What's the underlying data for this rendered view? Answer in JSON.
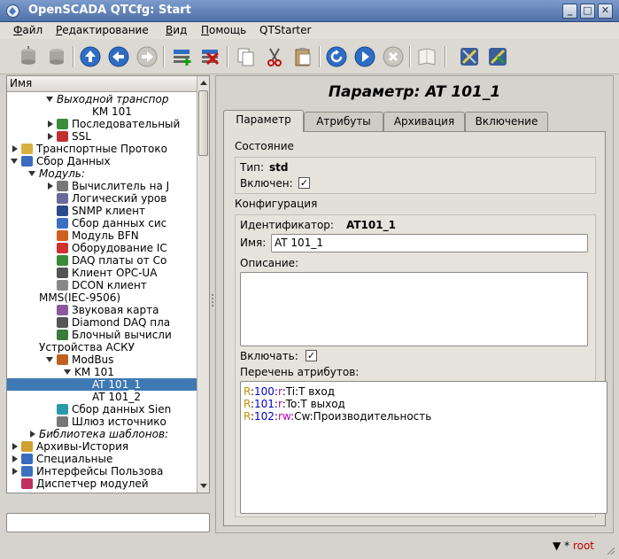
{
  "window": {
    "title": "OpenSCADA QTCfg: Start"
  },
  "menu": [
    {
      "label": "Файл",
      "underline": "Ф",
      "rest": "айл"
    },
    {
      "label": "Редактирование",
      "underline": "Р",
      "rest": "едактирование"
    },
    {
      "label": "Вид",
      "underline": "В",
      "rest": "ид"
    },
    {
      "label": "Помощь",
      "underline": "П",
      "rest": "омощь"
    },
    {
      "label": "QTStarter",
      "underline": "",
      "rest": "QTStarter"
    }
  ],
  "toolbar": {
    "icons": [
      "db-load-icon",
      "db-save-icon",
      "up-icon",
      "back-icon",
      "forward-icon",
      "add-item-icon",
      "delete-item-icon",
      "copy-icon",
      "cut-icon",
      "paste-icon",
      "refresh-icon",
      "start-icon",
      "stop-icon",
      "manual-icon",
      "tools-icon-1",
      "tools-icon-2"
    ]
  },
  "tree": {
    "header": "Имя",
    "rows": [
      {
        "label": "Выходной транспор",
        "indent": 3,
        "arrow": "down",
        "italic": true,
        "icon": ""
      },
      {
        "label": "KM 101",
        "indent": 5,
        "arrow": "",
        "italic": false,
        "icon": ""
      },
      {
        "label": "Последовательный",
        "indent": 3,
        "arrow": "right",
        "italic": false,
        "icon": "serial-icon"
      },
      {
        "label": "SSL",
        "indent": 3,
        "arrow": "right",
        "italic": false,
        "icon": "ssl-icon"
      },
      {
        "label": "Транспортные Протоко",
        "indent": 1,
        "arrow": "right",
        "italic": false,
        "icon": "folder-icon"
      },
      {
        "label": "Сбор Данных",
        "indent": 1,
        "arrow": "down",
        "italic": false,
        "icon": "daq-icon"
      },
      {
        "label": "Модуль:",
        "indent": 2,
        "arrow": "down",
        "italic": true,
        "icon": ""
      },
      {
        "label": "Вычислитель на J",
        "indent": 3,
        "arrow": "right",
        "italic": false,
        "icon": "calc-icon"
      },
      {
        "label": "Логический уров",
        "indent": 3,
        "arrow": "",
        "italic": false,
        "icon": "logic-icon"
      },
      {
        "label": "SNMP клиент",
        "indent": 3,
        "arrow": "",
        "italic": false,
        "icon": "snmp-icon"
      },
      {
        "label": "Сбор данных сис",
        "indent": 3,
        "arrow": "",
        "italic": false,
        "icon": "system-icon"
      },
      {
        "label": "Модуль BFN",
        "indent": 3,
        "arrow": "",
        "italic": false,
        "icon": "bfn-icon"
      },
      {
        "label": "Оборудование IC",
        "indent": 3,
        "arrow": "",
        "italic": false,
        "icon": "icp-icon"
      },
      {
        "label": "DAQ платы от Co",
        "indent": 3,
        "arrow": "",
        "italic": false,
        "icon": "daqboard-icon"
      },
      {
        "label": "Клиент OPC-UA",
        "indent": 3,
        "arrow": "",
        "italic": false,
        "icon": "opcua-icon"
      },
      {
        "label": "DCON клиент",
        "indent": 3,
        "arrow": "",
        "italic": false,
        "icon": "dcon-icon"
      },
      {
        "label": "MMS(IEC-9506)",
        "indent": 2,
        "arrow": "",
        "italic": false,
        "icon": ""
      },
      {
        "label": "Звуковая карта",
        "indent": 3,
        "arrow": "",
        "italic": false,
        "icon": "soundcard-icon"
      },
      {
        "label": "Diamond DAQ пла",
        "indent": 3,
        "arrow": "",
        "italic": false,
        "icon": "diamond-icon"
      },
      {
        "label": "Блочный вычисли",
        "indent": 3,
        "arrow": "",
        "italic": false,
        "icon": "block-calc-icon"
      },
      {
        "label": "Устройства АСКУ",
        "indent": 2,
        "arrow": "",
        "italic": false,
        "icon": ""
      },
      {
        "label": "ModBus",
        "indent": 3,
        "arrow": "down",
        "italic": false,
        "icon": "modbus-icon"
      },
      {
        "label": "KM 101",
        "indent": 4,
        "arrow": "down",
        "italic": false,
        "icon": ""
      },
      {
        "label": "AT 101_1",
        "indent": 5,
        "arrow": "",
        "italic": false,
        "icon": "",
        "selected": true
      },
      {
        "label": "AT 101_2",
        "indent": 5,
        "arrow": "",
        "italic": false,
        "icon": ""
      },
      {
        "label": "Сбор данных Sien",
        "indent": 3,
        "arrow": "",
        "italic": false,
        "icon": "siemens-icon"
      },
      {
        "label": "Шлюз источнико",
        "indent": 3,
        "arrow": "",
        "italic": false,
        "icon": "gateway-icon"
      },
      {
        "label": "Библиотека шаблонов:",
        "indent": 2,
        "arrow": "right",
        "italic": true,
        "icon": ""
      },
      {
        "label": "Архивы-История",
        "indent": 1,
        "arrow": "right",
        "italic": false,
        "icon": "archive-icon"
      },
      {
        "label": "Специальные",
        "indent": 1,
        "arrow": "right",
        "italic": false,
        "icon": "special-icon"
      },
      {
        "label": "Интерфейсы Пользова",
        "indent": 1,
        "arrow": "right",
        "italic": false,
        "icon": "ui-icon"
      },
      {
        "label": "Диспетчер модулей",
        "indent": 1,
        "arrow": "",
        "italic": false,
        "icon": "modsched-icon"
      }
    ]
  },
  "param": {
    "title": "Параметр: AT 101_1",
    "tabs": [
      "Параметр",
      "Атрибуты",
      "Архивация",
      "Включение"
    ],
    "state_label": "Состояние",
    "type_label": "Тип:",
    "type_value": "std",
    "enabled_label": "Включен:",
    "config_label": "Конфигурация",
    "id_label": "Идентификатор:",
    "id_value": "AT101_1",
    "name_label": "Имя:",
    "name_value": "AT 101_1",
    "descr_label": "Описание:",
    "enable_label": "Включать:",
    "attrlist_label": "Перечень атрибутов:",
    "attrs": [
      {
        "r": "R",
        "sep1": ":",
        "num": "100",
        "sep2": ":",
        "mode": "r",
        "rest": ":Ti:T вход"
      },
      {
        "r": "R",
        "sep1": ":",
        "num": "101",
        "sep2": ":",
        "mode": "r",
        "rest": ":To:T выход"
      },
      {
        "r": "R",
        "sep1": ":",
        "num": "102",
        "sep2": ":",
        "mode": "rw",
        "rest": ":Cw:Производительность"
      }
    ]
  },
  "status": {
    "star": "*",
    "user": "root"
  }
}
